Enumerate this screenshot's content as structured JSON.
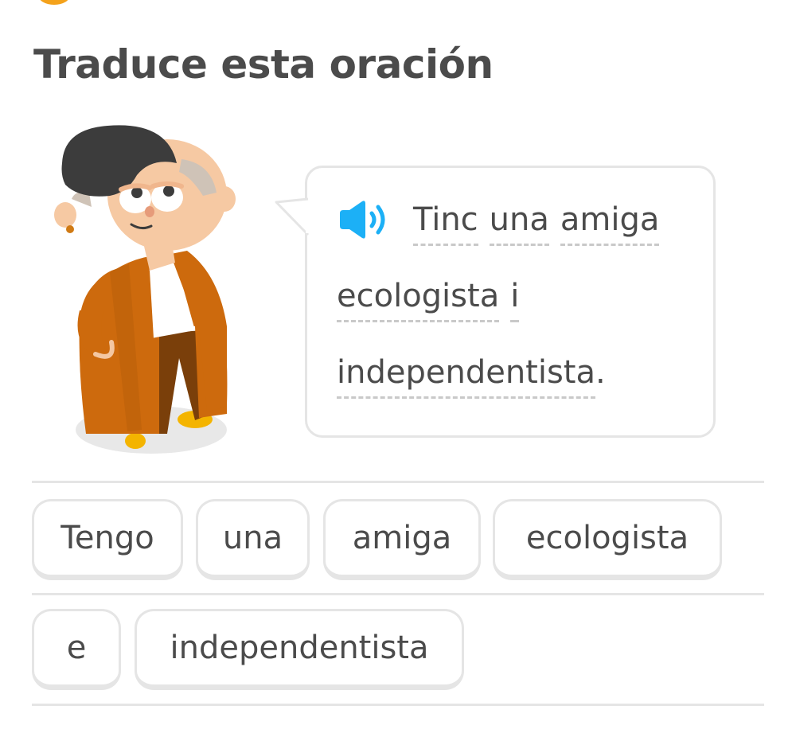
{
  "instruction": "Traduce esta oración",
  "prompt": {
    "line1": [
      "Tinc",
      "una",
      "amiga"
    ],
    "line2": [
      "ecologista",
      "i"
    ],
    "line3_word": "independentista",
    "line3_punct": "."
  },
  "word_bank": {
    "row1": [
      "Tengo",
      "una",
      "amiga",
      "ecologista"
    ],
    "row2": [
      "e",
      "independentista"
    ]
  },
  "icons": {
    "speaker": "speaker-icon",
    "character": "character-illustration"
  },
  "colors": {
    "text": "#4b4b4b",
    "border": "#e5e5e5",
    "speaker_blue": "#1cb0f6",
    "coat": "#cd6a0d",
    "hair": "#3c3c3c"
  }
}
